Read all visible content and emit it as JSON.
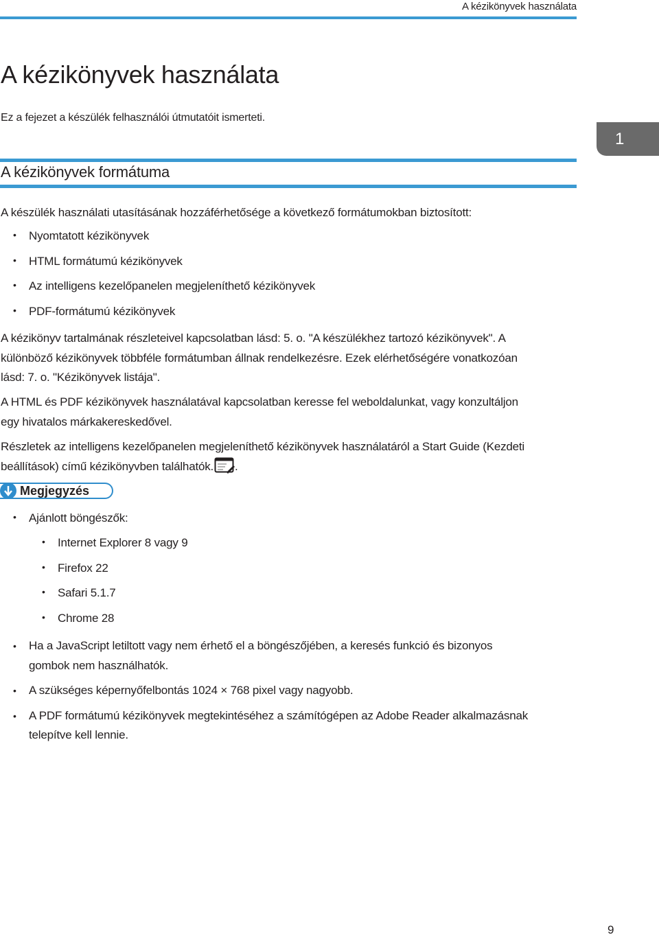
{
  "header": {
    "running_title": "A kézikönyvek használata"
  },
  "chapter": {
    "title": "A kézikönyvek használata",
    "intro": "Ez a fejezet a készülék felhasználói útmutatóit ismerteti.",
    "tab_number": "1"
  },
  "section": {
    "title": "A kézikönyvek formátuma",
    "lead": "A készülék használati utasításának hozzáférhetősége a következő formátumokban biztosított:",
    "formats": [
      "Nyomtatott kézikönyvek",
      "HTML formátumú kézikönyvek",
      "Az intelligens kezelőpanelen megjeleníthető kézikönyvek",
      "PDF-formátumú kézikönyvek"
    ],
    "para1_line1": "A kézikönyv tartalmának részleteivel kapcsolatban lásd: 5. o. \"A készülékhez tartozó kézikönyvek\". A",
    "para1_line2": "különböző kézikönyvek többféle formátumban állnak rendelkezésre. Ezek elérhetőségére vonatkozóan",
    "para1_line3": "lásd: 7. o. \"Kézikönyvek listája\".",
    "para2_line1": "A HTML és PDF kézikönyvek használatával kapcsolatban keresse fel weboldalunkat, vagy konzultáljon",
    "para2_line2": "egy hivatalos márkakereskedővel.",
    "para3_line1": "Részletek az intelligens kezelőpanelen megjeleníthető kézikönyvek használatáról a Start Guide (Kezdeti",
    "para3_line2": "beállítások) című kézikönyvben találhatók.",
    "para3_end": "."
  },
  "note": {
    "label": "Megjegyzés",
    "browsers_label": "Ajánlott böngészők:",
    "browsers": [
      "Internet Explorer 8 vagy 9",
      "Firefox 22",
      "Safari 5.1.7",
      "Chrome 28"
    ],
    "js_line1": "Ha a JavaScript letiltott vagy nem érhető el a böngészőjében, a keresés funkció és bizonyos",
    "js_line2": "gombok nem használhatók.",
    "resolution": "A szükséges képernyőfelbontás 1024 × 768 pixel vagy nagyobb.",
    "pdf_line1": "A PDF formátumú kézikönyvek megtekintéséhez a számítógépen az Adobe Reader alkalmazásnak",
    "pdf_line2": "telepítve kell lennie.",
    "bullet": "•"
  },
  "footer": {
    "page_number": "9"
  },
  "colors": {
    "accent": "#3b9ad2",
    "tab": "#6a6a6a",
    "note": "#2f8dcc",
    "text": "#231f20"
  }
}
